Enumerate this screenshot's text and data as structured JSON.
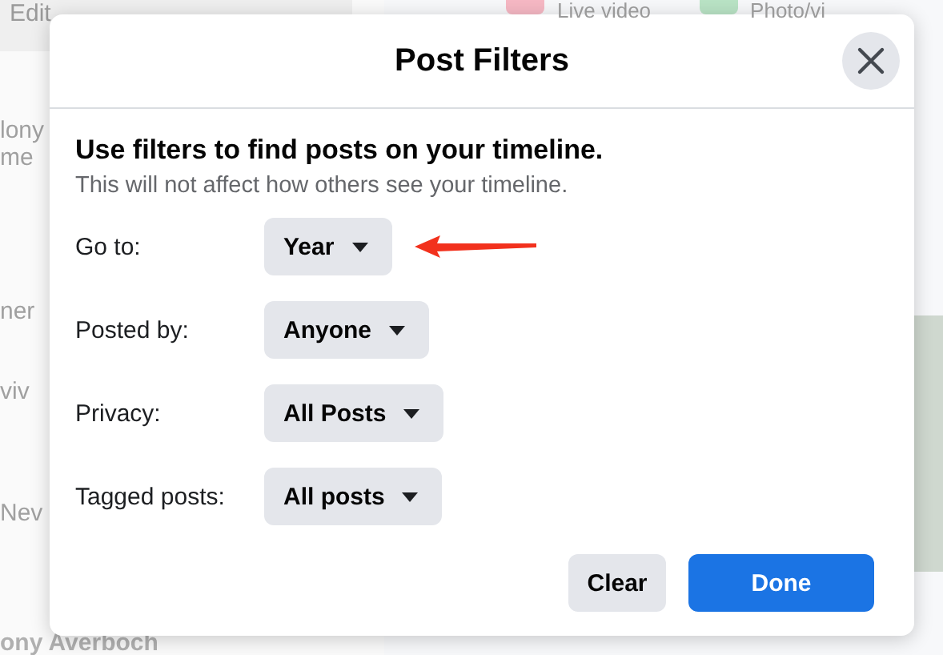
{
  "background": {
    "profile_button": "Edit",
    "composer_actions": [
      "Live video",
      "Photo/vi"
    ],
    "sidebar_texts": [
      "lony",
      "me",
      "ner",
      "viv",
      "Nev"
    ],
    "friend_name": "ony Averboch"
  },
  "dialog": {
    "title": "Post Filters",
    "heading": "Use filters to find posts on your timeline.",
    "subtitle": "This will not affect how others see your timeline.",
    "filters": [
      {
        "label": "Go to:",
        "value": "Year",
        "pointed": true
      },
      {
        "label": "Posted by:",
        "value": "Anyone",
        "pointed": false
      },
      {
        "label": "Privacy:",
        "value": "All Posts",
        "pointed": false
      },
      {
        "label": "Tagged posts:",
        "value": "All posts",
        "pointed": false
      }
    ],
    "buttons": [
      {
        "label": "Clear",
        "kind": "secondary"
      },
      {
        "label": "Done",
        "kind": "primary"
      }
    ]
  }
}
